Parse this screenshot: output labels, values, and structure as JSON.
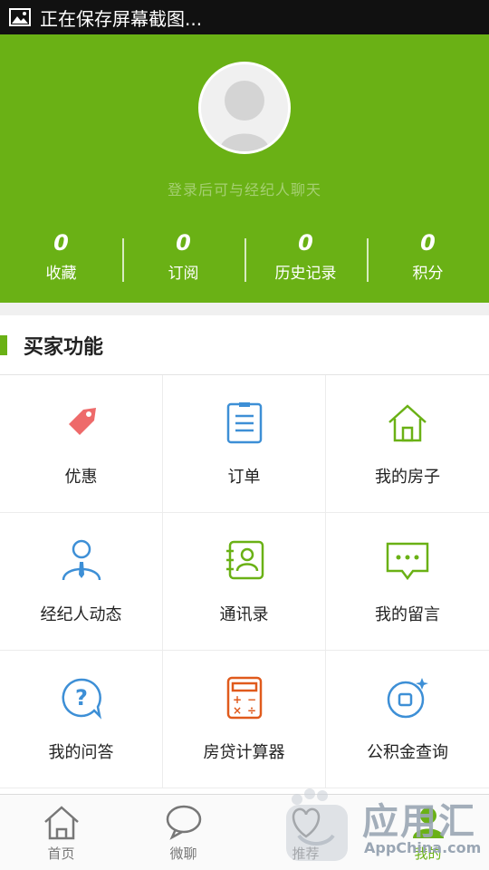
{
  "status_bar": {
    "notification": "正在保存屏幕截图..."
  },
  "header": {
    "login_hint": "登录后可与经纪人聊天",
    "stats": [
      {
        "value": "0",
        "label": "收藏"
      },
      {
        "value": "0",
        "label": "订阅"
      },
      {
        "value": "0",
        "label": "历史记录"
      },
      {
        "value": "0",
        "label": "积分"
      }
    ]
  },
  "section": {
    "title": "买家功能"
  },
  "features": [
    {
      "label": "优惠",
      "icon": "tag-icon"
    },
    {
      "label": "订单",
      "icon": "clipboard-icon"
    },
    {
      "label": "我的房子",
      "icon": "house-icon"
    },
    {
      "label": "经纪人动态",
      "icon": "agent-icon"
    },
    {
      "label": "通讯录",
      "icon": "contacts-icon"
    },
    {
      "label": "我的留言",
      "icon": "message-icon"
    },
    {
      "label": "我的问答",
      "icon": "question-icon"
    },
    {
      "label": "房贷计算器",
      "icon": "calculator-icon"
    },
    {
      "label": "公积金查询",
      "icon": "fund-query-icon"
    }
  ],
  "tabs": [
    {
      "label": "首页",
      "icon": "home-icon"
    },
    {
      "label": "微聊",
      "icon": "chat-icon"
    },
    {
      "label": "推荐",
      "icon": "recommend-icon"
    },
    {
      "label": "我的",
      "icon": "profile-icon",
      "active": true
    }
  ],
  "watermark": {
    "text": "应用汇",
    "sub": "AppChina.com"
  },
  "colors": {
    "brand_green": "#6ab115",
    "tag_red": "#ee6a6a",
    "blue": "#3d8fd6",
    "orange": "#e05a1c"
  }
}
